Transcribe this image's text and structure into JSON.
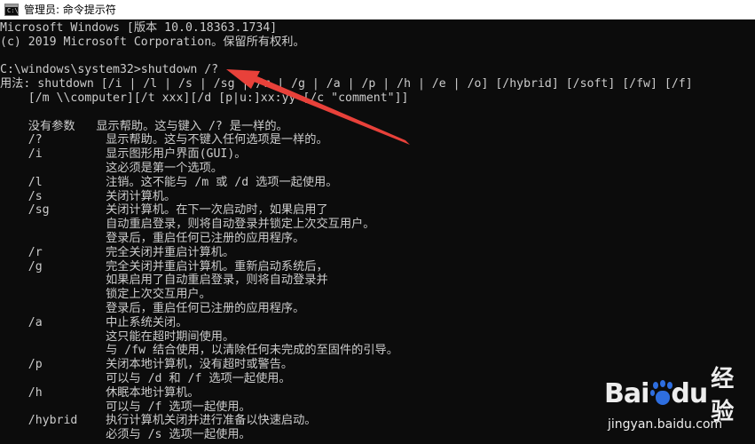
{
  "window": {
    "title": "管理员: 命令提示符",
    "icon": "cmd-icon",
    "icon_text": "C:\\"
  },
  "console": {
    "lines": [
      "Microsoft Windows [版本 10.0.18363.1734]",
      "(c) 2019 Microsoft Corporation。保留所有权利。",
      "",
      "C:\\windows\\system32>shutdown /?",
      "用法: shutdown [/i | /l | /s | /sg | /r | /g | /a | /p | /h | /e | /o] [/hybrid] [/soft] [/fw] [/f]",
      "    [/m \\\\computer][/t xxx][/d [p|u:]xx:yy [/c \"comment\"]]",
      "",
      "    没有参数   显示帮助。这与键入 /? 是一样的。",
      "    /?         显示帮助。这与不键入任何选项是一样的。",
      "    /i         显示图形用户界面(GUI)。",
      "               这必须是第一个选项。",
      "    /l         注销。这不能与 /m 或 /d 选项一起使用。",
      "    /s         关闭计算机。",
      "    /sg        关闭计算机。在下一次启动时，如果启用了",
      "               自动重启登录，则将自动登录并锁定上次交互用户。",
      "               登录后，重启任何已注册的应用程序。",
      "    /r         完全关闭并重启计算机。",
      "    /g         完全关闭并重启计算机。重新启动系统后，",
      "               如果启用了自动重启登录，则将自动登录并",
      "               锁定上次交互用户。",
      "               登录后，重启任何已注册的应用程序。",
      "    /a         中止系统关闭。",
      "               这只能在超时期间使用。",
      "               与 /fw 结合使用，以清除任何未完成的至固件的引导。",
      "    /p         关闭本地计算机，没有超时或警告。",
      "               可以与 /d 和 /f 选项一起使用。",
      "    /h         休眠本地计算机。",
      "               可以与 /f 选项一起使用。",
      "    /hybrid    执行计算机关闭并进行准备以快速启动。",
      "               必须与 /s 选项一起使用。"
    ]
  },
  "annotation": {
    "arrow_color": "#e8413a"
  },
  "watermark": {
    "logo_part1": "Bai",
    "logo_part2": "du",
    "logo_cn": "经验",
    "url": "jingyan.baidu.com"
  }
}
